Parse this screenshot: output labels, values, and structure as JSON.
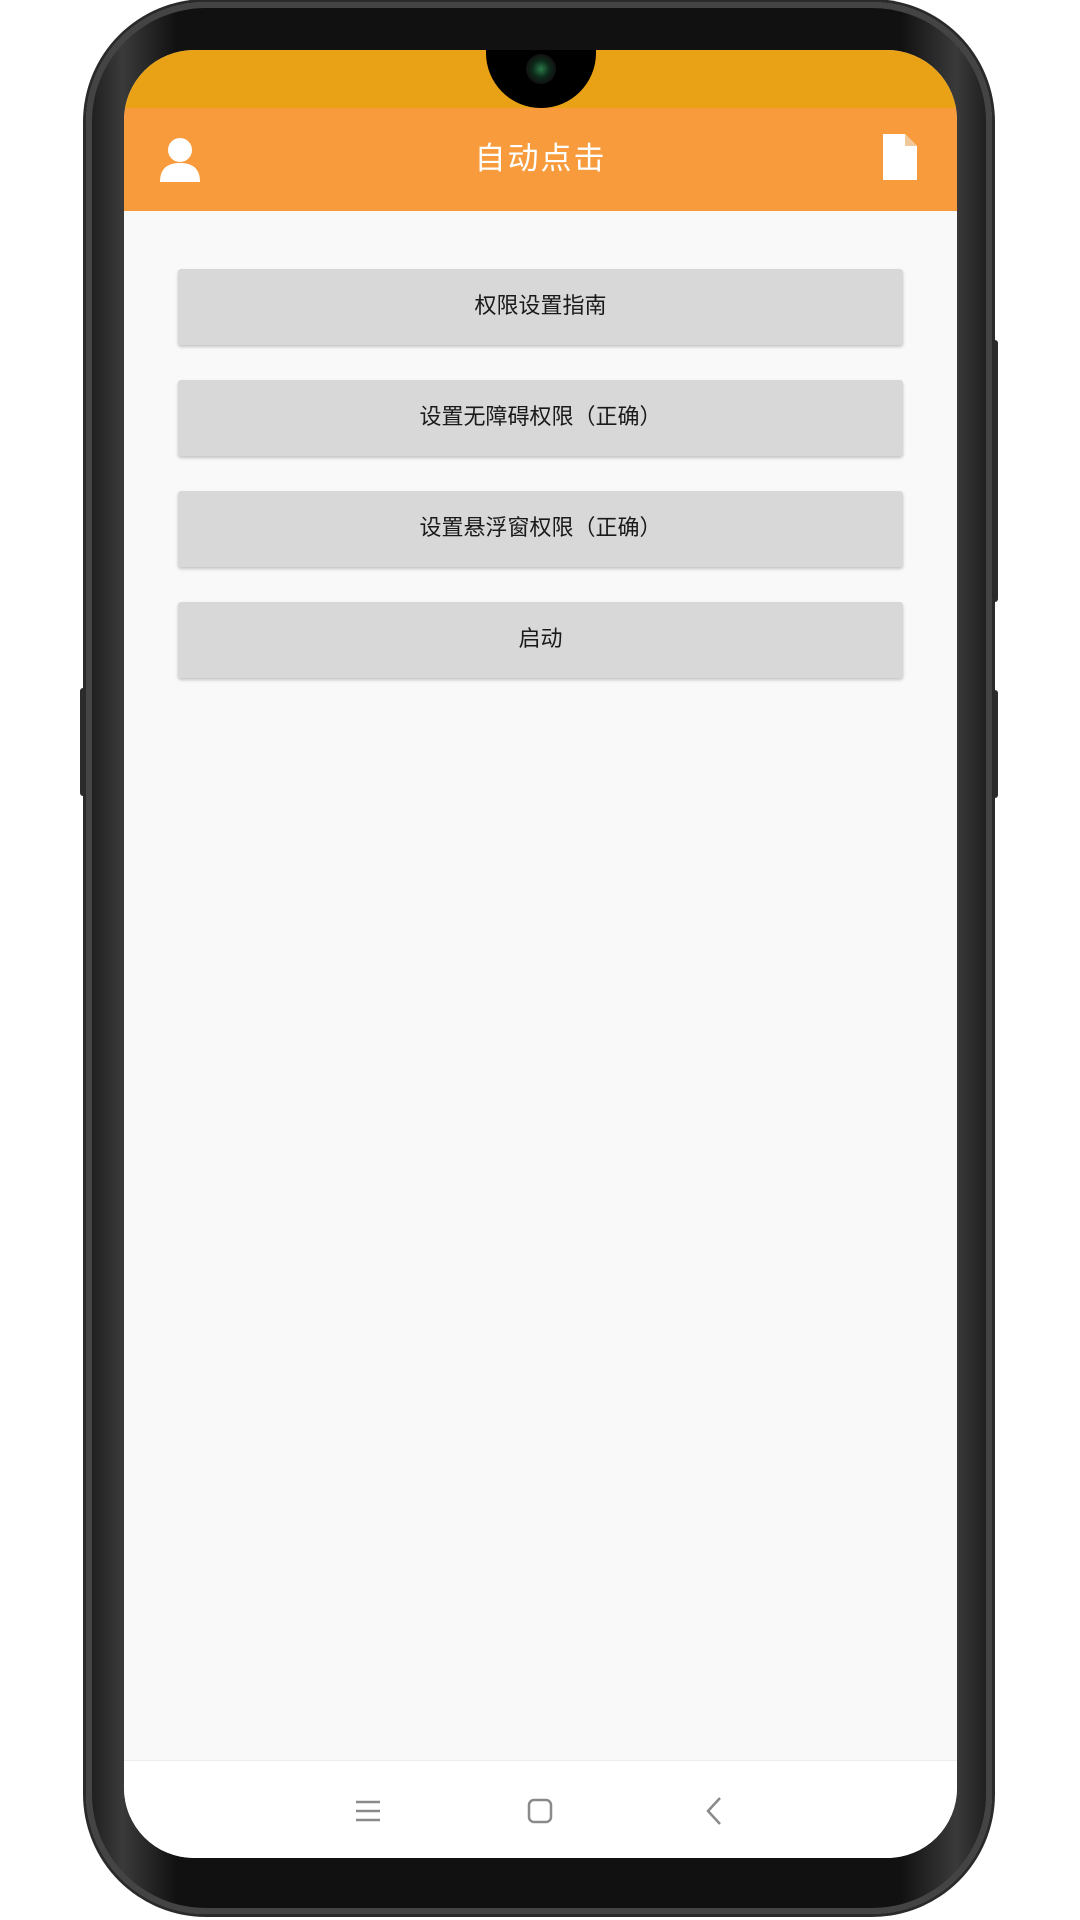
{
  "app_bar": {
    "title": "自动点击",
    "left_icon": "user-icon",
    "right_icon": "document-icon",
    "color": "#f79b3c"
  },
  "status_bar": {
    "color": "#e9a116"
  },
  "buttons": [
    {
      "label": "权限设置指南"
    },
    {
      "label": "设置无障碍权限（正确）"
    },
    {
      "label": "设置悬浮窗权限（正确）"
    },
    {
      "label": "启动"
    }
  ],
  "nav_bar": {
    "items": [
      "menu-icon",
      "home-icon",
      "back-icon"
    ]
  }
}
